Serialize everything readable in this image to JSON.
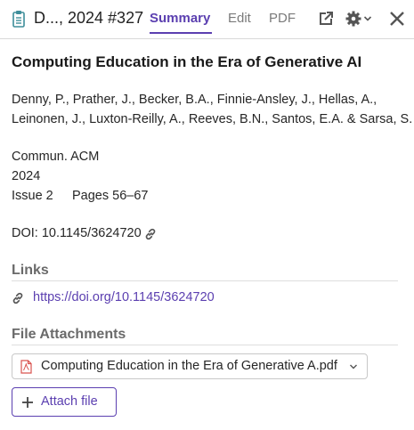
{
  "header": {
    "ref_title": "D..., 2024 #327",
    "tabs": [
      {
        "label": "Summary",
        "active": true
      },
      {
        "label": "Edit",
        "active": false
      },
      {
        "label": "PDF",
        "active": false
      }
    ],
    "icons": [
      "clipboard-icon",
      "open-external-icon",
      "gear-icon",
      "chevron-down-icon",
      "close-icon"
    ]
  },
  "reference": {
    "title": "Computing Education in the Era of Generative AI",
    "authors_line1": "Denny, P., Prather, J., Becker, B.A., Finnie-Ansley, J., Hellas, A.,",
    "authors_line2": "Leinonen, J., Luxton-Reilly, A., Reeves, B.N., Santos, E.A. & Sarsa, S.",
    "journal": "Commun. ACM",
    "year": "2024",
    "issue": "Issue 2",
    "pages": "Pages 56–67",
    "doi": "DOI: 10.1145/3624720"
  },
  "links": {
    "heading": "Links",
    "url": "https://doi.org/10.1145/3624720"
  },
  "attachments": {
    "heading": "File Attachments",
    "file_name": "Computing Education in the Era of Generative A.pdf",
    "attach_label": "Attach file"
  },
  "colors": {
    "accent": "#5b3fb0",
    "clipboard_icon": "#3e8e9a",
    "pdf_icon": "#d9534f"
  }
}
